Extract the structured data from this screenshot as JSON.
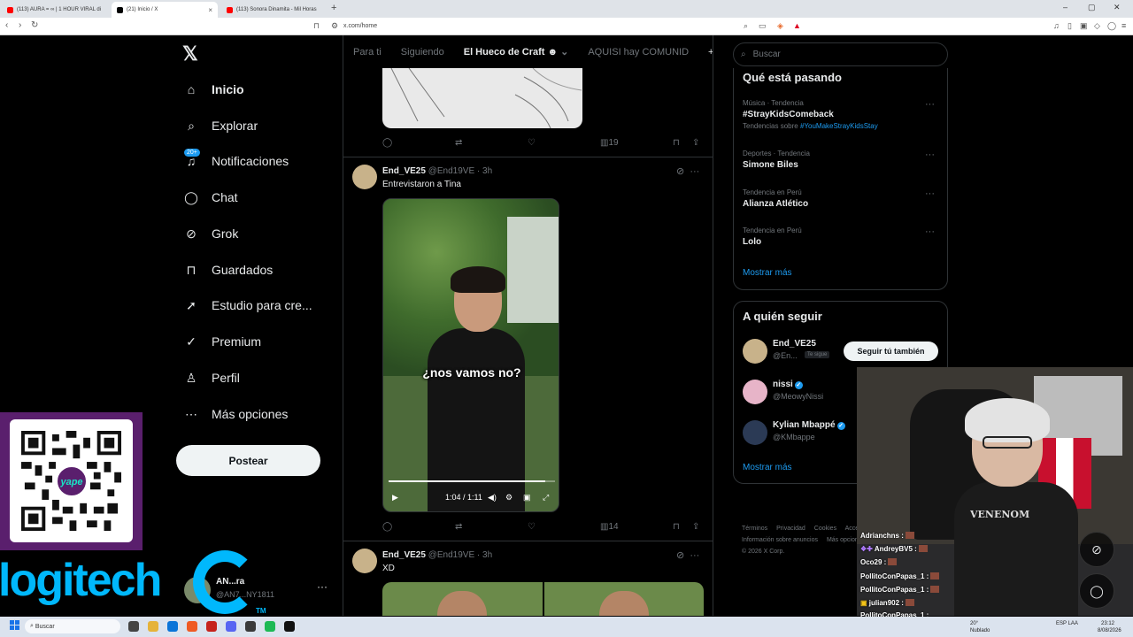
{
  "browser": {
    "tabs": [
      {
        "title": "(113) AURA = ∞ | 1 HOUR VIRAL di",
        "active": false,
        "icon": "youtube-icon"
      },
      {
        "title": "(21) Inicio / X",
        "active": true,
        "icon": "x-icon"
      },
      {
        "title": "(113) Sonora Dinamita - Mil Horas",
        "active": false,
        "icon": "youtube-icon"
      }
    ],
    "new_tab": "+",
    "url": "x.com/home",
    "window_controls": [
      "–",
      "▢",
      "✕"
    ]
  },
  "nav": {
    "logo": "𝕏",
    "items": [
      {
        "label": "Inicio",
        "icon": "home-icon",
        "glyph": "⌂",
        "active": true
      },
      {
        "label": "Explorar",
        "icon": "search-icon",
        "glyph": "⌕"
      },
      {
        "label": "Notificaciones",
        "icon": "bell-icon",
        "glyph": "♫",
        "badge": "20+"
      },
      {
        "label": "Chat",
        "icon": "chat-icon",
        "glyph": "◯"
      },
      {
        "label": "Grok",
        "icon": "grok-icon",
        "glyph": "⊘"
      },
      {
        "label": "Guardados",
        "icon": "bookmark-icon",
        "glyph": "⊓"
      },
      {
        "label": "Estudio para cre...",
        "icon": "rocket-icon",
        "glyph": "➚"
      },
      {
        "label": "Premium",
        "icon": "verified-icon",
        "glyph": "✓"
      },
      {
        "label": "Perfil",
        "icon": "person-icon",
        "glyph": "♙"
      },
      {
        "label": "Más opciones",
        "icon": "more-circle-icon",
        "glyph": "⋯"
      }
    ],
    "post_button": "Postear",
    "account": {
      "name": "AN...ra",
      "handle": "@AN7...NY1811",
      "more": "···"
    }
  },
  "timeline": {
    "tabs": [
      "Para ti",
      "Siguiendo",
      "El Hueco de Craft",
      "AQUISI hay COMUNID"
    ],
    "active_tab": 2,
    "add_tab": "+",
    "first_post_actions": {
      "views": "19"
    },
    "posts": [
      {
        "author": "End_VE25",
        "handle": "@End19VE",
        "time": "3h",
        "text": "Entrevistaron a Tina",
        "video": {
          "caption": "¿nos vamos no?",
          "time": "1:04 / 1:11",
          "progress": 0.94
        },
        "views": "14"
      },
      {
        "author": "End_VE25",
        "handle": "@End19VE",
        "time": "3h",
        "text": "XD"
      }
    ]
  },
  "sidebar": {
    "search_placeholder": "Buscar",
    "trends_title": "Qué está pasando",
    "trends": [
      {
        "context": "Música · Tendencia",
        "title": "#StrayKidsComeback",
        "sub_prefix": "Tendencias sobre",
        "sub_link": "#YouMakeStrayKidsStay"
      },
      {
        "context": "Deportes · Tendencia",
        "title": "Simone Biles"
      },
      {
        "context": "Tendencia en Perú",
        "title": "Alianza Atlético"
      },
      {
        "context": "Tendencia en Perú",
        "title": "Lolo"
      }
    ],
    "show_more": "Mostrar más",
    "who_title": "A quién seguir",
    "who": [
      {
        "name": "End_VE25",
        "handle": "@En...",
        "tag": "Te sigue",
        "button": "Seguir tú también",
        "color": "#c8b28a"
      },
      {
        "name": "nissi",
        "handle": "@MeowyNissi",
        "verified": true,
        "color": "#e7b4c8"
      },
      {
        "name": "Kylian Mbappé",
        "handle": "@KMbappe",
        "verified": true,
        "color": "#2b3a55"
      }
    ],
    "who_show_more": "Mostrar más",
    "footer": [
      "Términos",
      "Privacidad",
      "Cookies",
      "Accesibilidad",
      "Información sobre anuncios",
      "Más opciones ···",
      "© 2026 X Corp."
    ]
  },
  "overlay": {
    "qr_brand": "yape",
    "sponsor": "logitech",
    "sponsor_tm": "TM",
    "shirt_text": "VENENOM",
    "chat": [
      {
        "user": "Adrianchns :"
      },
      {
        "user": "AndreyBV5 :"
      },
      {
        "user": "Oco29 :"
      },
      {
        "user": "PollitoConPapas_1 :"
      },
      {
        "user": "PollitoConPapas_1 :"
      },
      {
        "user": "julian902 :"
      },
      {
        "user": "PollitoConPapas_1 :"
      }
    ]
  },
  "taskbar": {
    "search": "Buscar",
    "temp": "20°",
    "weather": "Nublado",
    "lang": "ESP LAA",
    "time": "23:12",
    "date": "8/08/2026"
  },
  "colors": {
    "accent": "#1d9bf0",
    "background": "#000000",
    "border": "#2f3336",
    "muted": "#71767b",
    "sponsor": "#00b8fc"
  }
}
